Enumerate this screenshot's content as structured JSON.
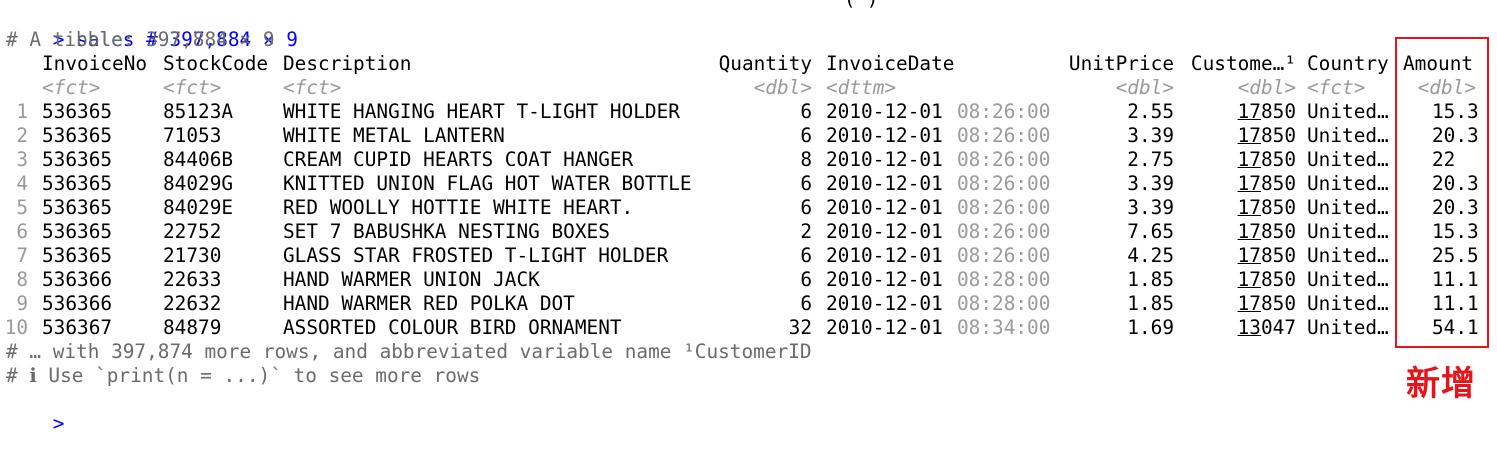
{
  "command": {
    "prompt": ">",
    "text": "sales # 397,884 × 9"
  },
  "tibble_header": "# A tibble: 397,884 × 9",
  "columns": [
    {
      "name": "",
      "type": ""
    },
    {
      "name": "InvoiceNo",
      "type": "<fct>"
    },
    {
      "name": "StockCode",
      "type": "<fct>"
    },
    {
      "name": "Description",
      "type": "<fct>"
    },
    {
      "name": "Quantity",
      "type": "<dbl>"
    },
    {
      "name": "InvoiceDate",
      "type": "<dttm>"
    },
    {
      "name": "UnitPrice",
      "type": "<dbl>"
    },
    {
      "name": "Custome…¹",
      "type": "<dbl>"
    },
    {
      "name": "Country",
      "type": "<fct>"
    },
    {
      "name": "Amount",
      "type": "<dbl>"
    }
  ],
  "rows": [
    {
      "n": "1",
      "invoice": "536365",
      "stock": "85123A",
      "desc": "WHITE HANGING HEART T-LIGHT HOLDER",
      "qty": "6",
      "date": "2010-12-01",
      "time": "08:26:00",
      "price": "2.55",
      "cust_hi": "17",
      "cust_lo": "850",
      "country": "United…",
      "amount": "15.3"
    },
    {
      "n": "2",
      "invoice": "536365",
      "stock": "71053",
      "desc": "WHITE METAL LANTERN",
      "qty": "6",
      "date": "2010-12-01",
      "time": "08:26:00",
      "price": "3.39",
      "cust_hi": "17",
      "cust_lo": "850",
      "country": "United…",
      "amount": "20.3"
    },
    {
      "n": "3",
      "invoice": "536365",
      "stock": "84406B",
      "desc": "CREAM CUPID HEARTS COAT HANGER",
      "qty": "8",
      "date": "2010-12-01",
      "time": "08:26:00",
      "price": "2.75",
      "cust_hi": "17",
      "cust_lo": "850",
      "country": "United…",
      "amount": "22"
    },
    {
      "n": "4",
      "invoice": "536365",
      "stock": "84029G",
      "desc": "KNITTED UNION FLAG HOT WATER BOTTLE",
      "qty": "6",
      "date": "2010-12-01",
      "time": "08:26:00",
      "price": "3.39",
      "cust_hi": "17",
      "cust_lo": "850",
      "country": "United…",
      "amount": "20.3"
    },
    {
      "n": "5",
      "invoice": "536365",
      "stock": "84029E",
      "desc": "RED WOOLLY HOTTIE WHITE HEART.",
      "qty": "6",
      "date": "2010-12-01",
      "time": "08:26:00",
      "price": "3.39",
      "cust_hi": "17",
      "cust_lo": "850",
      "country": "United…",
      "amount": "20.3"
    },
    {
      "n": "6",
      "invoice": "536365",
      "stock": "22752",
      "desc": "SET 7 BABUSHKA NESTING BOXES",
      "qty": "2",
      "date": "2010-12-01",
      "time": "08:26:00",
      "price": "7.65",
      "cust_hi": "17",
      "cust_lo": "850",
      "country": "United…",
      "amount": "15.3"
    },
    {
      "n": "7",
      "invoice": "536365",
      "stock": "21730",
      "desc": "GLASS STAR FROSTED T-LIGHT HOLDER",
      "qty": "6",
      "date": "2010-12-01",
      "time": "08:26:00",
      "price": "4.25",
      "cust_hi": "17",
      "cust_lo": "850",
      "country": "United…",
      "amount": "25.5"
    },
    {
      "n": "8",
      "invoice": "536366",
      "stock": "22633",
      "desc": "HAND WARMER UNION JACK",
      "qty": "6",
      "date": "2010-12-01",
      "time": "08:28:00",
      "price": "1.85",
      "cust_hi": "17",
      "cust_lo": "850",
      "country": "United…",
      "amount": "11.1"
    },
    {
      "n": "9",
      "invoice": "536366",
      "stock": "22632",
      "desc": "HAND WARMER RED POLKA DOT",
      "qty": "6",
      "date": "2010-12-01",
      "time": "08:28:00",
      "price": "1.85",
      "cust_hi": "17",
      "cust_lo": "850",
      "country": "United…",
      "amount": "11.1"
    },
    {
      "n": "10",
      "invoice": "536367",
      "stock": "84879",
      "desc": "ASSORTED COLOUR BIRD ORNAMENT",
      "qty": "32",
      "date": "2010-12-01",
      "time": "08:34:00",
      "price": "1.69",
      "cust_hi": "13",
      "cust_lo": "047",
      "country": "United…",
      "amount": "54.1"
    }
  ],
  "footer": {
    "more_rows": "# … with 397,874 more rows, and abbreviated variable name ¹CustomerID",
    "hint": "# ℹ Use `print(n = ...)` to see more rows"
  },
  "final_prompt": ">",
  "annotation": {
    "label": "新增",
    "color": "#e8141b"
  },
  "colors": {
    "prompt": "#0000ff",
    "comment": "#6b6b6b",
    "dim": "#9a9a9a",
    "highlight": "#e8141b"
  }
}
